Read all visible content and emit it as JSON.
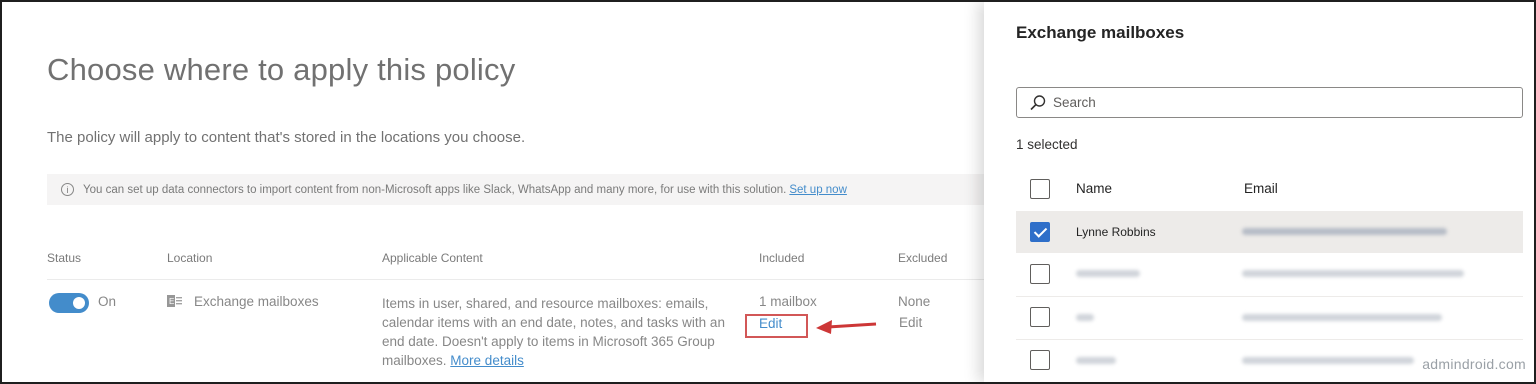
{
  "page": {
    "title": "Choose where to apply this policy",
    "description": "The policy will apply to content that's stored in the locations you choose.",
    "info_bar": {
      "icon": "info-icon",
      "text": "You can set up data connectors to import content from non-Microsoft apps like Slack, WhatsApp and many more, for use with this solution.",
      "link": "Set up now"
    },
    "table": {
      "headers": {
        "status": "Status",
        "location": "Location",
        "content": "Applicable Content",
        "included": "Included",
        "excluded": "Excluded"
      },
      "row": {
        "status_label": "On",
        "location_icon": "exchange-icon",
        "location": "Exchange mailboxes",
        "content": "Items in user, shared, and resource mailboxes: emails, calendar items with an end date, notes, and tasks with an end date. Doesn't apply to items in Microsoft 365 Group mailboxes.",
        "content_link": "More details",
        "included_value": "1 mailbox",
        "included_edit": "Edit",
        "excluded_value": "None",
        "excluded_edit": "Edit"
      }
    }
  },
  "panel": {
    "title": "Exchange mailboxes",
    "search_placeholder": "Search",
    "selected_count": "1 selected",
    "columns": {
      "name": "Name",
      "email": "Email"
    },
    "rows": [
      {
        "name": "Lynne Robbins",
        "checked": true
      }
    ]
  },
  "watermark": "admindroid.com",
  "colors": {
    "accent": "#0f6cbd",
    "highlight": "#c62828",
    "selected_row": "#edebe9"
  }
}
